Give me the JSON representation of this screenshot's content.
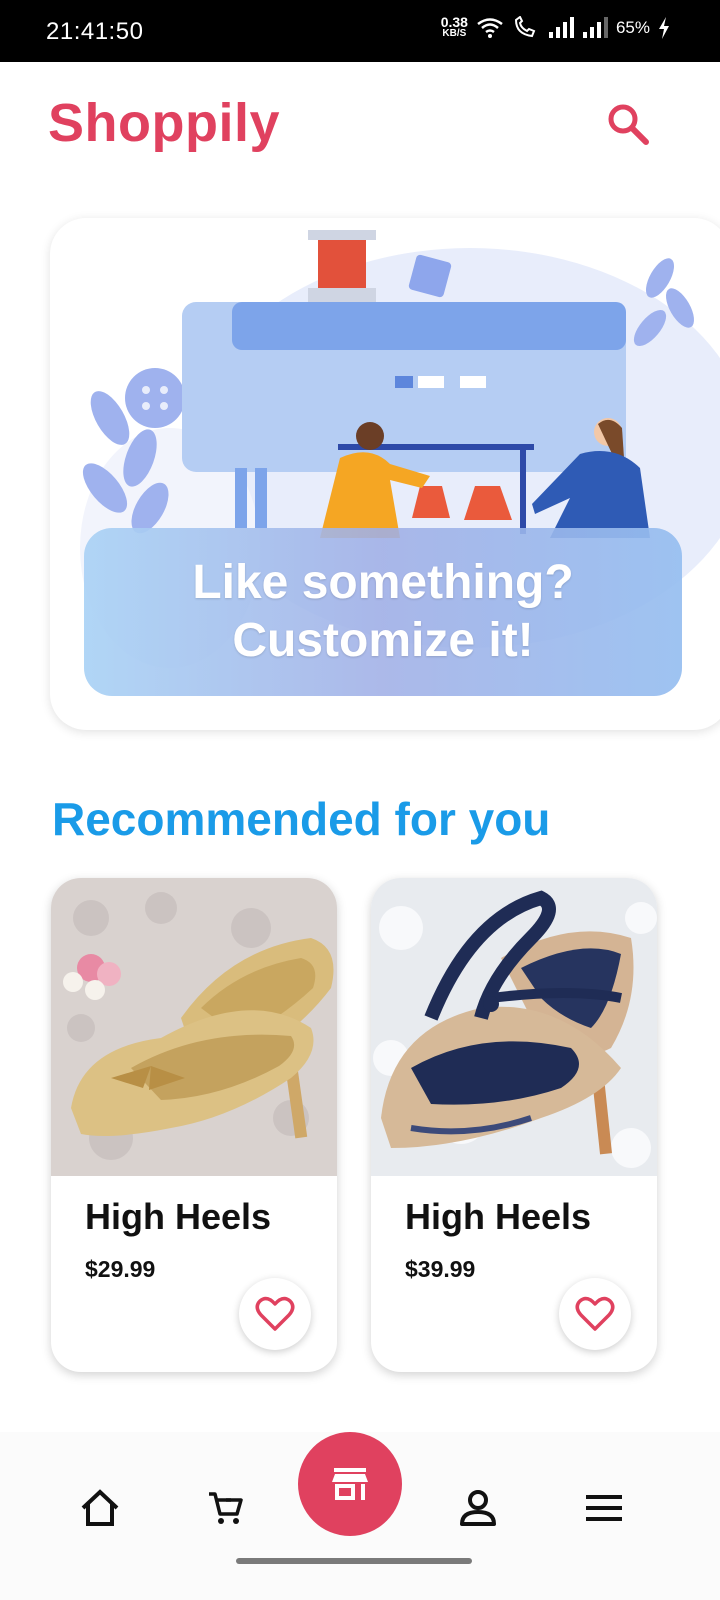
{
  "status_bar": {
    "time": "21:41:50",
    "net_speed_value": "0.38",
    "net_speed_unit": "KB/S",
    "battery": "65%"
  },
  "header": {
    "title": "Shoppily",
    "search_icon": "search-icon"
  },
  "banner": {
    "line1": "Like something?",
    "line2": "Customize it!"
  },
  "section": {
    "title": "Recommended for you"
  },
  "products": [
    {
      "name": "High Heels",
      "price": "$29.99",
      "favorite_icon": "heart-outline-icon"
    },
    {
      "name": "High Heels",
      "price": "$39.99",
      "favorite_icon": "heart-outline-icon"
    }
  ],
  "bottom_nav": {
    "items": [
      "home-icon",
      "cart-icon",
      "store-icon",
      "profile-icon",
      "menu-icon"
    ]
  },
  "colors": {
    "brand": "#e0415f",
    "section_title": "#1a9be8",
    "text": "#111111"
  }
}
